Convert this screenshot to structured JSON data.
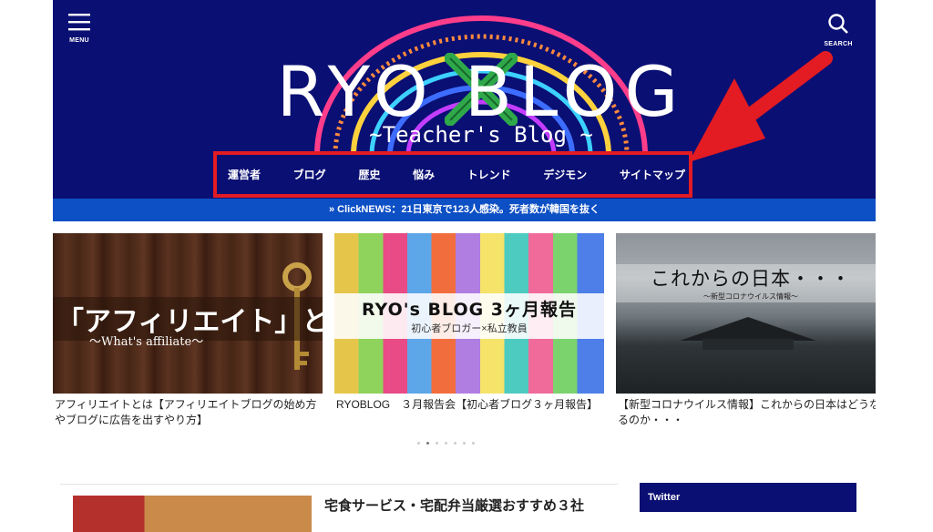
{
  "header": {
    "menu_label": "MENU",
    "search_label": "SEARCH",
    "logo_title": "RYO  BLOG",
    "logo_subtitle": "~Teacher's Blog ~",
    "nav": [
      "運営者",
      "ブログ",
      "歴史",
      "悩み",
      "トレンド",
      "デジモン",
      "サイトマップ"
    ]
  },
  "ticker": {
    "text": "» ClickNEWS：21日東京で123人感染。死者数が韓国を抜く"
  },
  "cards": [
    {
      "thumb_title": "「アフィリエイト」とは",
      "thumb_subtitle": "～What's affiliate～",
      "caption": "アフィリエイトとは【アフィリエイトブログの始め方やブログに広告を出すやり方】"
    },
    {
      "thumb_title": "RYO's BLOG 3ヶ月報告",
      "thumb_subtitle": "初心者ブロガー×私立教員",
      "caption": "RYOBLOG　３月報告会【初心者ブログ３ヶ月報告】"
    },
    {
      "thumb_title": "これからの日本・・・",
      "thumb_subtitle": "～新型コロナウイルス情報～",
      "caption": "【新型コロナウイルス情報】これからの日本はどうなるのか・・・"
    }
  ],
  "post": {
    "title": "宅食サービス・宅配弁当厳選おすすめ３社"
  },
  "sidebar": {
    "twitter_label": "Twitter"
  },
  "colors": {
    "header_bg": "#0a0f73",
    "ticker_bg": "#0d4fc4",
    "highlight": "#e31b23"
  },
  "slider": {
    "dots": 7,
    "active": 2
  }
}
